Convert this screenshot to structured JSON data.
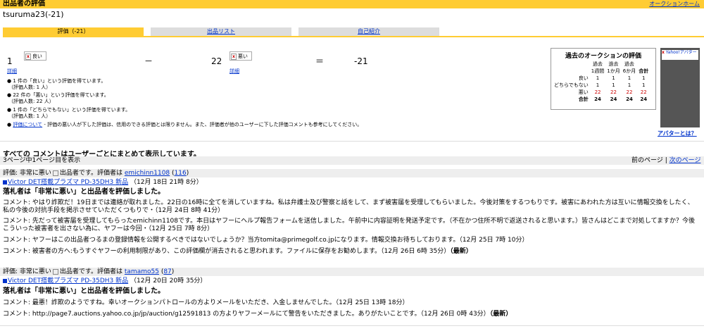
{
  "header": {
    "title": "出品者の評価",
    "home_link": "オークションホーム"
  },
  "user": {
    "display": "tsuruma23(-21)"
  },
  "tabs": [
    {
      "label": "評価（-21）",
      "active": true
    },
    {
      "label": "出品リスト",
      "active": false
    },
    {
      "label": "自己紹介",
      "active": false
    }
  ],
  "summary": {
    "good_count": "1",
    "good_label": "良い",
    "good_detail": "詳細",
    "minus": "－",
    "bad_count": "22",
    "bad_label": "悪い",
    "bad_detail": "詳細",
    "equals": "＝",
    "total": "-21",
    "bullets": [
      {
        "main": "1 件の「良い」という評価を得ています。",
        "sub": "（評価人数: 1 人）"
      },
      {
        "main": "22 件の「悪い」という評価を得ています。",
        "sub": "（評価人数: 22 人）"
      },
      {
        "main": "1 件の「どちらでもない」という評価を得ています。",
        "sub": "（評価人数: 1 人）"
      }
    ],
    "about_link": "評価について",
    "about_text": " - 評価の悪い人が下した評価は、信用のできる評価とは限りません。また、評価者が他のユーザーに下した評価コメントも参考にしてください。"
  },
  "history": {
    "title": "過去のオークションの評価",
    "head1": [
      "過去",
      "過去",
      "過去",
      ""
    ],
    "head2": [
      "1週間",
      "1か月",
      "6か月",
      "合計"
    ],
    "rows": [
      {
        "label": "良い",
        "v": [
          "1",
          "1",
          "1",
          "1"
        ]
      },
      {
        "label": "どちらでもない",
        "v": [
          "1",
          "1",
          "1",
          "1"
        ]
      },
      {
        "label": "悪い",
        "v": [
          "22",
          "22",
          "22",
          "22"
        ]
      },
      {
        "label": "合計",
        "v": [
          "24",
          "24",
          "24",
          "24"
        ]
      }
    ]
  },
  "avatar": {
    "alt": "Yahoo!アバター",
    "link": "アバターとは？"
  },
  "comments_note": "すべての コメントはユーザーごとにまとめて表示しています。",
  "pagination": {
    "info": "3ページ中1ページ目を表示",
    "prev": "前のページ",
    "divider": "|",
    "next": "次のページ"
  },
  "entries": [
    {
      "rating_prefix": "評価: 非常に悪い",
      "role": "出品者です。評価者は",
      "rater": "emichinn1108",
      "rater_score": "116",
      "item": "Victor DET搭載プラズマ PD-35DH3 新品",
      "item_time": "（12月 18日 21時 8分）",
      "verdict": "落札者は「非常に悪い」と出品者を評価しました。",
      "comments": [
        {
          "text": "コメント: やはり詐欺だ！19日までは連絡が取れました。22日の16時に全てを消していますね。私は弁護士及び警察と話をして、まず被害届を受理してもらいました。今後対策をするつもりです。被害にあわれた方は互いに情報交換をしたく、私の今後の対抗手段を掲示させていただくつもりで・（12月 24日 8時 41分）",
          "latest": ""
        },
        {
          "text": "コメント: 先だって被害届を受理してもらったemichinn1108です。本日はヤフーにヘルプ報告フォームを送信しました。午前中に内容証明を発送予定です。（不在かつ住所不明で返送されると思います。）皆さんはどこまで対処してますか？今後こういった被害者を出さない為に、ヤフーは今回・（12月 25日 7時 8分）",
          "latest": ""
        },
        {
          "text": "コメント: ヤフーはこの出品者つるまの登録情報を公開するべきではないでしょうか？当方tomita@primegolf.co.jpになります。情報交換お待ちしております。（12月 25日 7時 10分）",
          "latest": ""
        },
        {
          "text": "コメント: 被害者の方へ:もうすぐヤフーの利用制限があり、この評価欄が消去されると思われます。ファイルに保存をお勧めします。（12月 26日 6時 35分）",
          "latest": "（最新）"
        }
      ]
    },
    {
      "rating_prefix": "評価: 非常に悪い",
      "role": "出品者です。評価者は",
      "rater": "tamamo55",
      "rater_score": "87",
      "item": "Victor DET搭載プラズマ PD-35DH3 新品",
      "item_time": "（12月 20日 20時 35分）",
      "verdict": "落札者は「非常に悪い」と出品者を評価しました。",
      "comments": [
        {
          "text": "コメント: 最悪！詐欺のようですね。幸いオークションパトロールの方よりメールをいただき、入金しませんでした。（12月 25日 13時 18分）",
          "latest": ""
        },
        {
          "text": "コメント: http://page7.auctions.yahoo.co.jp/jp/auction/g12591813 の方よりヤフーメールにて警告をいただきました。ありがたいことです。（12月 26日 0時 43分）",
          "latest": "（最新）"
        }
      ]
    }
  ]
}
